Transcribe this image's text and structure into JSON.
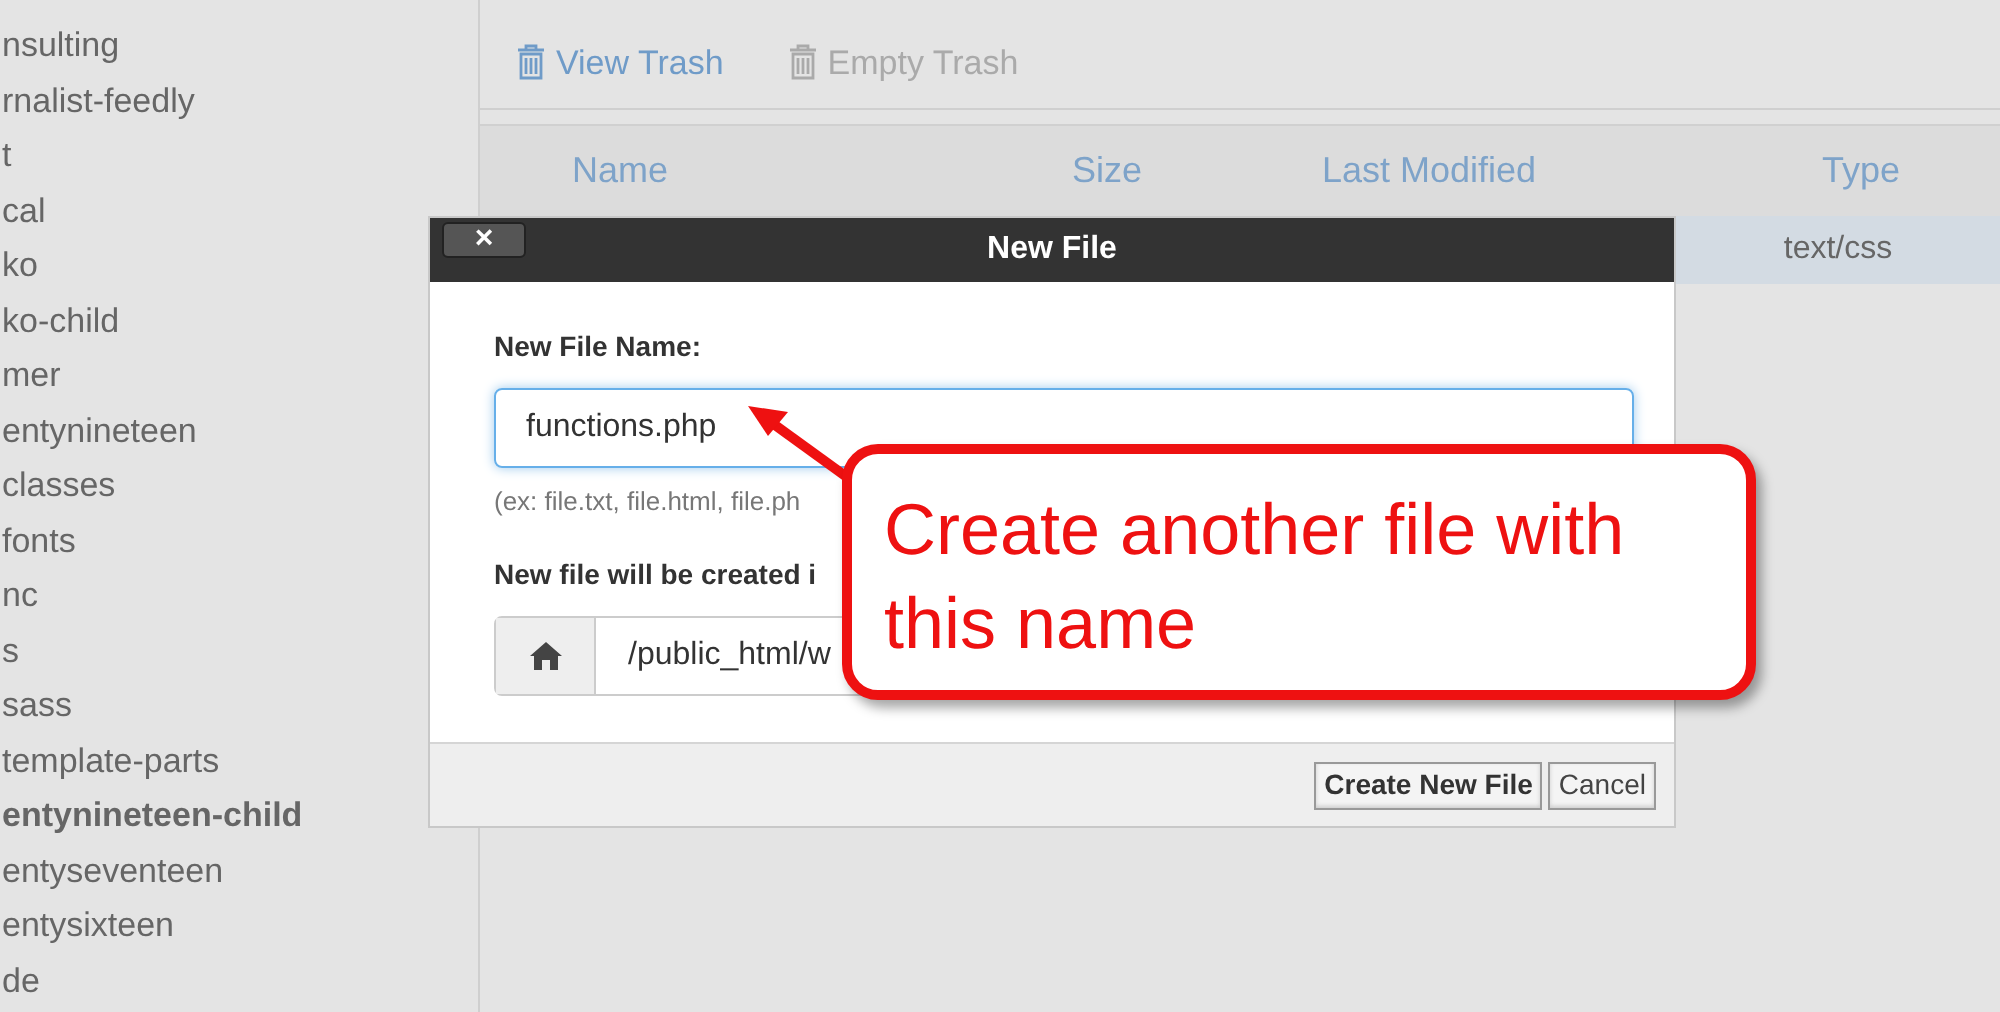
{
  "sidebar": {
    "items": [
      {
        "label": "nsulting",
        "selected": false
      },
      {
        "label": "rnalist-feedly",
        "selected": false
      },
      {
        "label": "t",
        "selected": false
      },
      {
        "label": "cal",
        "selected": false
      },
      {
        "label": "ko",
        "selected": false
      },
      {
        "label": "ko-child",
        "selected": false
      },
      {
        "label": "mer",
        "selected": false
      },
      {
        "label": "entynineteen",
        "selected": false
      },
      {
        "label": "classes",
        "selected": false
      },
      {
        "label": "fonts",
        "selected": false
      },
      {
        "label": "nc",
        "selected": false
      },
      {
        "label": "s",
        "selected": false
      },
      {
        "label": "sass",
        "selected": false
      },
      {
        "label": "template-parts",
        "selected": false
      },
      {
        "label": "entynineteen-child",
        "selected": true
      },
      {
        "label": "entyseventeen",
        "selected": false
      },
      {
        "label": "entysixteen",
        "selected": false
      },
      {
        "label": "de",
        "selected": false
      }
    ]
  },
  "toolbar": [
    {
      "label": "View Trash",
      "disabled": false
    },
    {
      "label": "Empty Trash",
      "disabled": true
    }
  ],
  "table": {
    "columns": [
      "Name",
      "Size",
      "Last Modified",
      "Type"
    ],
    "rows": [
      {
        "type": "text/css",
        "selected": true
      }
    ]
  },
  "dialog": {
    "title": "New File",
    "close": "×",
    "name_label": "New File Name:",
    "name_value": "functions.php",
    "hint": "(ex: file.txt, file.html, file.ph",
    "location_label": "New file will be created i",
    "location_value": "/public_html/w",
    "buttons": [
      "Create New File",
      "Cancel"
    ]
  },
  "callout": {
    "text": "Create another file with this name"
  }
}
